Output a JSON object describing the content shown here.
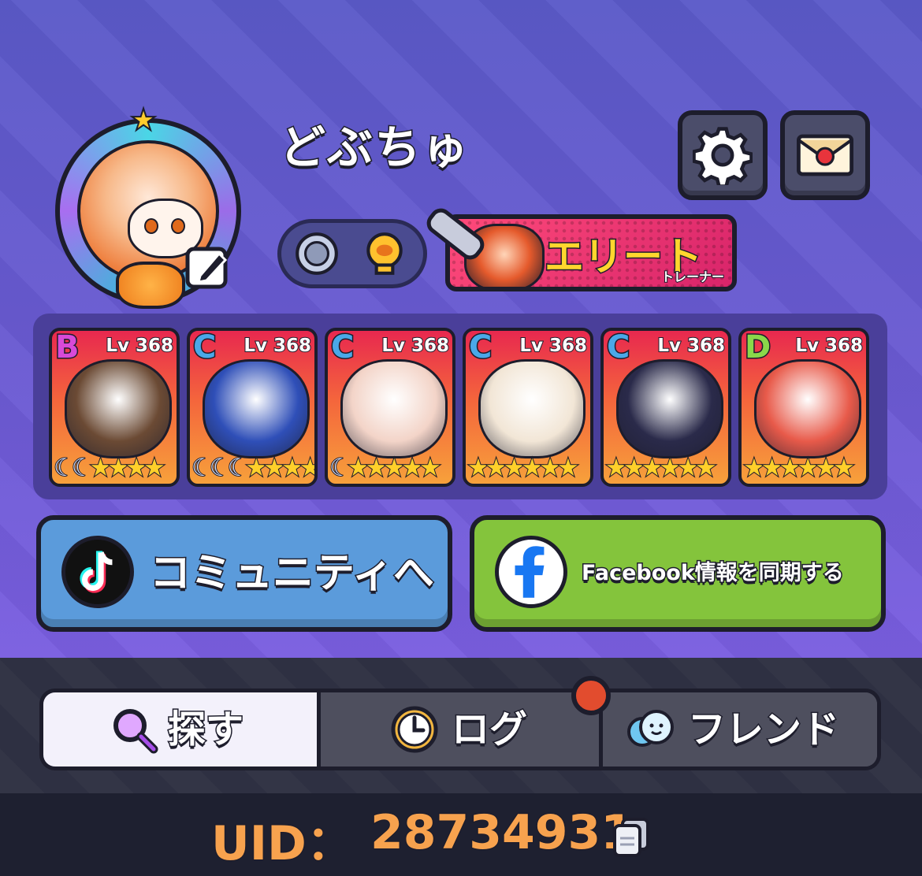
{
  "profile": {
    "name": "どぶちゅ",
    "title": {
      "main": "エリート",
      "sub": "トレーナー"
    }
  },
  "team": [
    {
      "rank": "B",
      "rank_color": "#d84ad8",
      "level": "Lv 368",
      "moons": 2,
      "stars": 4,
      "art_color": "#6b4a34"
    },
    {
      "rank": "C",
      "rank_color": "#4aa8e8",
      "level": "Lv 368",
      "moons": 3,
      "stars": 4,
      "art_color": "#2f4fb8"
    },
    {
      "rank": "C",
      "rank_color": "#4aa8e8",
      "level": "Lv 368",
      "moons": 1,
      "stars": 5,
      "art_color": "#f3d4c8"
    },
    {
      "rank": "C",
      "rank_color": "#4aa8e8",
      "level": "Lv 368",
      "moons": 0,
      "stars": 6,
      "art_color": "#f2e6d6"
    },
    {
      "rank": "C",
      "rank_color": "#4aa8e8",
      "level": "Lv 368",
      "moons": 0,
      "stars": 6,
      "art_color": "#2a2a4a"
    },
    {
      "rank": "D",
      "rank_color": "#8ad84a",
      "level": "Lv 368",
      "moons": 0,
      "stars": 6,
      "art_color": "#e85a4a"
    }
  ],
  "buttons": {
    "community": "コミュニティへ",
    "facebook": "Facebook情報を同期する"
  },
  "tabs": {
    "search": "探す",
    "log": "ログ",
    "friend": "フレンド",
    "active": "search"
  },
  "uid": {
    "label": "UID：",
    "value": "28734931"
  },
  "colors": {
    "accent_uid": "#f7a24e",
    "community_button": "#5b9bdb",
    "facebook_button": "#84c43c",
    "notification": "#e24c2e"
  }
}
